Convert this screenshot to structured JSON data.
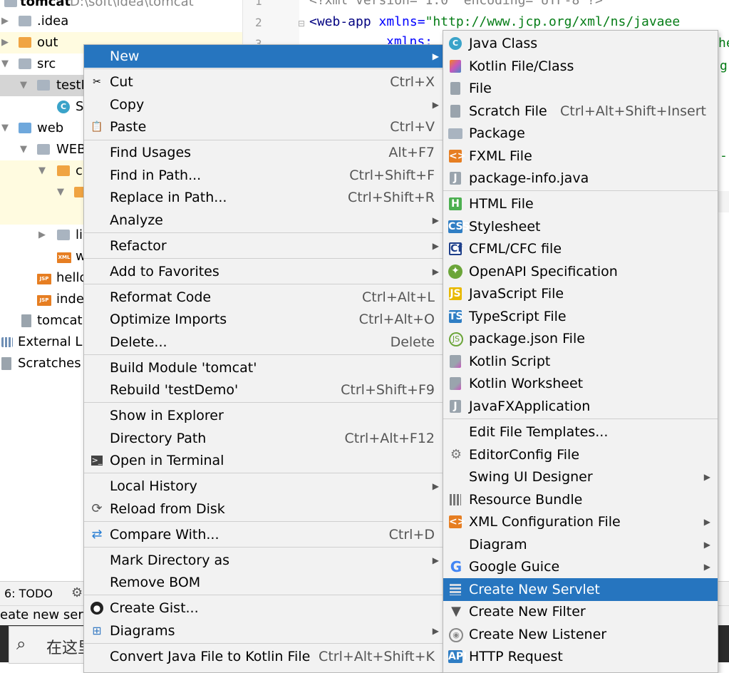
{
  "project_tree": {
    "root": {
      "name": "tomcat",
      "path": "D:\\soft\\idea\\tomcat"
    },
    "items": [
      {
        "label": ".idea"
      },
      {
        "label": "out"
      },
      {
        "label": "src"
      },
      {
        "label": "testD"
      },
      {
        "label": "S"
      },
      {
        "label": "web"
      },
      {
        "label": "WEB"
      },
      {
        "label": "c"
      },
      {
        "label": ""
      },
      {
        "label": "li"
      },
      {
        "label": "w"
      },
      {
        "label": "hello"
      },
      {
        "label": "inde"
      },
      {
        "label": "tomcat."
      },
      {
        "label": "External Lib"
      },
      {
        "label": "Scratches a"
      }
    ]
  },
  "editor": {
    "line_numbers": [
      "1",
      "2",
      "3"
    ],
    "lines": [
      {
        "pi": "<?xml version=\"1.0\" encoding=\"UTF-8\"?>"
      },
      {
        "tag_open": "<web-app",
        "attr": " xmlns=",
        "val": "\"http://www.jcp.org/xml/ns/javaee"
      },
      {
        "partial": "xmlns:"
      }
    ],
    "right_fragments": [
      "he",
      "g",
      "-"
    ]
  },
  "toolwindow": {
    "todo_label": "6: TODO"
  },
  "statusbar": {
    "text": "eate new servle"
  },
  "taskbar": {
    "search_text": "在这里"
  },
  "context_menu": {
    "items": [
      {
        "label": "New",
        "shortcut": "",
        "submenu": true,
        "icon": "",
        "active": true
      },
      {
        "label": "Cut",
        "shortcut": "Ctrl+X",
        "icon": "scissors-icon"
      },
      {
        "label": "Copy",
        "shortcut": "",
        "submenu": true,
        "icon": ""
      },
      {
        "label": "Paste",
        "shortcut": "Ctrl+V",
        "icon": "clipboard-icon"
      },
      {
        "label": "Find Usages",
        "shortcut": "Alt+F7",
        "icon": ""
      },
      {
        "label": "Find in Path...",
        "shortcut": "Ctrl+Shift+F",
        "icon": ""
      },
      {
        "label": "Replace in Path...",
        "shortcut": "Ctrl+Shift+R",
        "icon": ""
      },
      {
        "label": "Analyze",
        "shortcut": "",
        "submenu": true,
        "icon": ""
      },
      {
        "label": "Refactor",
        "shortcut": "",
        "submenu": true,
        "icon": ""
      },
      {
        "label": "Add to Favorites",
        "shortcut": "",
        "submenu": true,
        "icon": ""
      },
      {
        "label": "Reformat Code",
        "shortcut": "Ctrl+Alt+L",
        "icon": ""
      },
      {
        "label": "Optimize Imports",
        "shortcut": "Ctrl+Alt+O",
        "icon": ""
      },
      {
        "label": "Delete...",
        "shortcut": "Delete",
        "icon": ""
      },
      {
        "label": "Build Module 'tomcat'",
        "shortcut": "",
        "icon": ""
      },
      {
        "label": "Rebuild 'testDemo'",
        "shortcut": "Ctrl+Shift+F9",
        "icon": ""
      },
      {
        "label": "Show in Explorer",
        "shortcut": "",
        "icon": ""
      },
      {
        "label": "Directory Path",
        "shortcut": "Ctrl+Alt+F12",
        "icon": ""
      },
      {
        "label": "Open in Terminal",
        "shortcut": "",
        "icon": "terminal-icon"
      },
      {
        "label": "Local History",
        "shortcut": "",
        "submenu": true,
        "icon": ""
      },
      {
        "label": "Reload from Disk",
        "shortcut": "",
        "icon": "reload-icon"
      },
      {
        "label": "Compare With...",
        "shortcut": "Ctrl+D",
        "icon": "compare-icon"
      },
      {
        "label": "Mark Directory as",
        "shortcut": "",
        "submenu": true,
        "icon": ""
      },
      {
        "label": "Remove BOM",
        "shortcut": "",
        "icon": ""
      },
      {
        "label": "Create Gist...",
        "shortcut": "",
        "icon": "github-icon"
      },
      {
        "label": "Diagrams",
        "shortcut": "",
        "submenu": true,
        "icon": "diagram-icon"
      },
      {
        "label": "Convert Java File to Kotlin File",
        "shortcut": "Ctrl+Alt+Shift+K",
        "icon": ""
      }
    ]
  },
  "new_submenu": {
    "items": [
      {
        "label": "Java Class",
        "shortcut": "",
        "icon": "java-class-icon"
      },
      {
        "label": "Kotlin File/Class",
        "shortcut": "",
        "icon": "kotlin-file-icon"
      },
      {
        "label": "File",
        "shortcut": "",
        "icon": "file-icon"
      },
      {
        "label": "Scratch File",
        "shortcut": "Ctrl+Alt+Shift+Insert",
        "icon": "scratch-file-icon"
      },
      {
        "label": "Package",
        "shortcut": "",
        "icon": "package-icon"
      },
      {
        "label": "FXML File",
        "shortcut": "",
        "icon": "fxml-file-icon"
      },
      {
        "label": "package-info.java",
        "shortcut": "",
        "icon": "java-file-icon"
      },
      {
        "label": "HTML File",
        "shortcut": "",
        "icon": "html-file-icon"
      },
      {
        "label": "Stylesheet",
        "shortcut": "",
        "icon": "css-file-icon"
      },
      {
        "label": "CFML/CFC file",
        "shortcut": "",
        "icon": "cfml-file-icon"
      },
      {
        "label": "OpenAPI Specification",
        "shortcut": "",
        "icon": "openapi-icon"
      },
      {
        "label": "JavaScript File",
        "shortcut": "",
        "icon": "javascript-file-icon"
      },
      {
        "label": "TypeScript File",
        "shortcut": "",
        "icon": "typescript-file-icon"
      },
      {
        "label": "package.json File",
        "shortcut": "",
        "icon": "nodejs-icon"
      },
      {
        "label": "Kotlin Script",
        "shortcut": "",
        "icon": "kotlin-script-icon"
      },
      {
        "label": "Kotlin Worksheet",
        "shortcut": "",
        "icon": "kotlin-worksheet-icon"
      },
      {
        "label": "JavaFXApplication",
        "shortcut": "",
        "icon": "javafx-icon"
      },
      {
        "label": "Edit File Templates...",
        "shortcut": "",
        "icon": ""
      },
      {
        "label": "EditorConfig File",
        "shortcut": "",
        "icon": "gear-icon"
      },
      {
        "label": "Swing UI Designer",
        "shortcut": "",
        "submenu": true,
        "icon": ""
      },
      {
        "label": "Resource Bundle",
        "shortcut": "",
        "icon": "resource-bundle-icon"
      },
      {
        "label": "XML Configuration File",
        "shortcut": "",
        "submenu": true,
        "icon": "xml-file-icon"
      },
      {
        "label": "Diagram",
        "shortcut": "",
        "submenu": true,
        "icon": ""
      },
      {
        "label": "Google Guice",
        "shortcut": "",
        "submenu": true,
        "icon": "google-icon"
      },
      {
        "label": "Create New Servlet",
        "shortcut": "",
        "icon": "servlet-icon",
        "active": true
      },
      {
        "label": "Create New Filter",
        "shortcut": "",
        "icon": "filter-icon"
      },
      {
        "label": "Create New Listener",
        "shortcut": "",
        "icon": "listener-icon"
      },
      {
        "label": "HTTP Request",
        "shortcut": "",
        "icon": "api-icon"
      }
    ]
  },
  "colors": {
    "accent": "#2675bf",
    "menu_bg": "#f2f2f2"
  }
}
